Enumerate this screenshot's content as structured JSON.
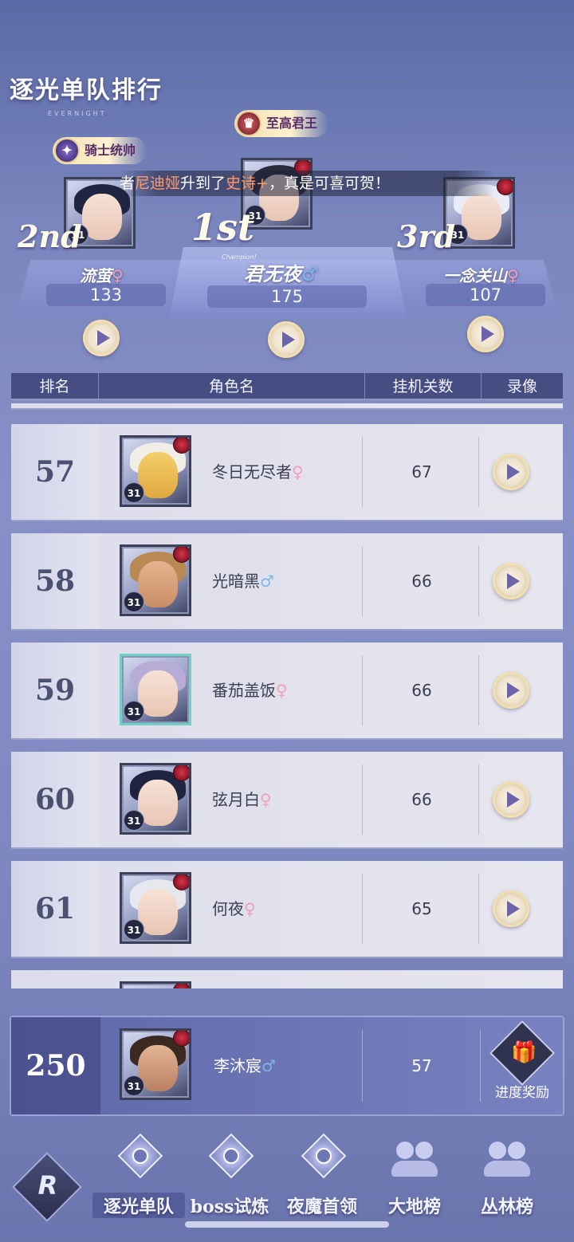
{
  "header": {
    "title": "逐光单队排行",
    "subtitle": "EVERNIGHT"
  },
  "announcement": {
    "prefix": "者",
    "name": "尼迪娅",
    "middle": "升到了",
    "rarity": "史诗+",
    "suffix": "，真是可喜可贺！"
  },
  "podium": {
    "champion_tag": "Champion!",
    "first": {
      "rank": "1st",
      "title": "至高君王",
      "name": "君无夜",
      "gender": "♂",
      "score": "175",
      "level": "31"
    },
    "second": {
      "rank": "2nd",
      "title": "骑士统帅",
      "name": "流萤",
      "gender": "♀",
      "score": "133",
      "level": "31"
    },
    "third": {
      "rank": "3rd",
      "name": "一念关山",
      "gender": "♀",
      "score": "107",
      "level": "31"
    }
  },
  "table": {
    "headers": {
      "rank": "排名",
      "name": "角色名",
      "stages": "挂机关数",
      "replay": "录像"
    },
    "rows": [
      {
        "rank": "57",
        "name": "冬日无尽者",
        "gender": "♀",
        "stages": "67",
        "level": "31"
      },
      {
        "rank": "58",
        "name": "光暗黑",
        "gender": "♂",
        "stages": "66",
        "level": "31"
      },
      {
        "rank": "59",
        "name": "番茄盖饭",
        "gender": "♀",
        "stages": "66",
        "level": "31"
      },
      {
        "rank": "60",
        "name": "弦月白",
        "gender": "♀",
        "stages": "66",
        "level": "31"
      },
      {
        "rank": "61",
        "name": "何夜",
        "gender": "♀",
        "stages": "65",
        "level": "31"
      }
    ]
  },
  "my_rank": {
    "rank": "250",
    "name": "李沐宸",
    "gender": "♂",
    "stages": "57",
    "level": "31",
    "reward_label": "进度奖励"
  },
  "nav": {
    "tabs": [
      {
        "label": "逐光单队",
        "active": true
      },
      {
        "label": "boss试炼"
      },
      {
        "label": "夜魔首领"
      },
      {
        "label": "大地榜"
      },
      {
        "label": "丛林榜"
      }
    ]
  },
  "colors": {
    "accent": "#6c64a8",
    "highlight": "#ff9a6a",
    "female": "#f0a0ba",
    "male": "#7fb6ea"
  }
}
